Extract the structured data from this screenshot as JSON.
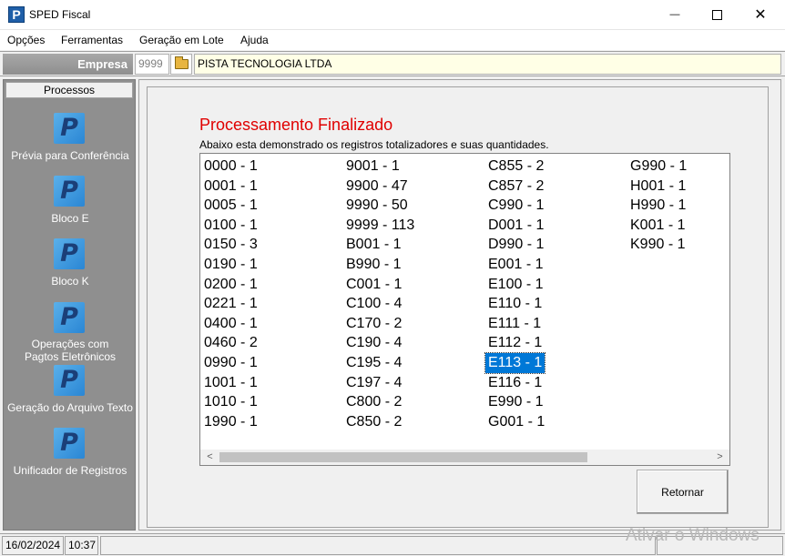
{
  "window": {
    "title": "SPED Fiscal",
    "icon_letter": "P",
    "minimize_glyph": "—",
    "close_glyph": "✕"
  },
  "menu": {
    "items": [
      "Opções",
      "Ferramentas",
      "Geração em Lote",
      "Ajuda"
    ]
  },
  "empresa": {
    "label": "Empresa",
    "code": "9999",
    "name": "PISTA TECNOLOGIA LTDA"
  },
  "sidebar": {
    "header": "Processos",
    "icon_letter": "P",
    "items": [
      {
        "label": "Prévia para Conferência"
      },
      {
        "label": "Bloco E"
      },
      {
        "label": "Bloco K"
      },
      {
        "label_line1": "Operações com",
        "label_line2": "Pagtos Eletrônicos"
      },
      {
        "label": "Geração do Arquivo Texto"
      },
      {
        "label": "Unificador de Registros"
      }
    ]
  },
  "main": {
    "title": "Processamento Finalizado",
    "subtitle": "Abaixo esta demonstrado os registros totalizadores e suas quantidades.",
    "columns": [
      [
        "0000 - 1",
        "0001 - 1",
        "0005 - 1",
        "0100 - 1",
        "0150 - 3",
        "0190 - 1",
        "0200 - 1",
        "0221 - 1",
        "0400 - 1",
        "0460 - 2",
        "0990 - 1",
        "1001 - 1",
        "1010 - 1",
        "1990 - 1"
      ],
      [
        "9001 - 1",
        "9900 - 47",
        "9990 - 50",
        "9999 - 113",
        "B001 - 1",
        "B990 - 1",
        "C001 - 1",
        "C100 - 4",
        "C170 - 2",
        "C190 - 4",
        "C195 - 4",
        "C197 - 4",
        "C800 - 2",
        "C850 - 2"
      ],
      [
        "C855 - 2",
        "C857 - 2",
        "C990 - 1",
        "D001 - 1",
        "D990 - 1",
        "E001 - 1",
        "E100 - 1",
        "E110 - 1",
        "E111 - 1",
        "E112 - 1",
        "E113 - 1",
        "E116 - 1",
        "E990 - 1",
        "G001 - 1"
      ],
      [
        "G990 - 1",
        "H001 - 1",
        "H990 - 1",
        "K001 - 1",
        "K990 - 1"
      ]
    ],
    "selected": "E113 - 1",
    "scroll_left": "<",
    "scroll_right": ">",
    "retornar_label": "Retornar"
  },
  "status": {
    "date": "16/02/2024",
    "time": "10:37"
  },
  "watermark": "Ativar o Windows"
}
